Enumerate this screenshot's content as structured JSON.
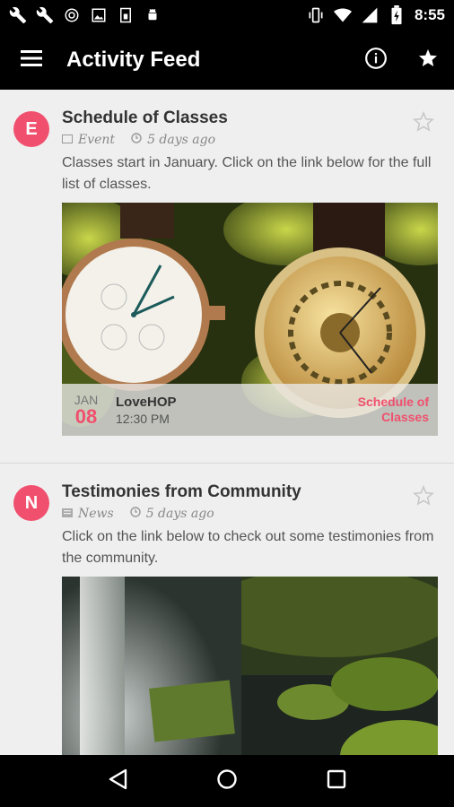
{
  "status": {
    "time": "8:55"
  },
  "appbar": {
    "title": "Activity Feed"
  },
  "feed": [
    {
      "avatar_letter": "E",
      "title": "Schedule of Classes",
      "type": "Event",
      "age": "5 days ago",
      "description": "Classes start in January. Click on the link below for the full list of classes.",
      "event": {
        "month": "JAN",
        "day": "08",
        "venue": "LoveHOP",
        "time": "12:30 PM",
        "tag": "Schedule of Classes"
      }
    },
    {
      "avatar_letter": "N",
      "title": "Testimonies from Community",
      "type": "News",
      "age": "5 days ago",
      "description": "Click on the link below to check out some testimonies from the community."
    }
  ],
  "colors": {
    "accent": "#f0506e",
    "bar": "#000000",
    "background": "#efefef"
  }
}
